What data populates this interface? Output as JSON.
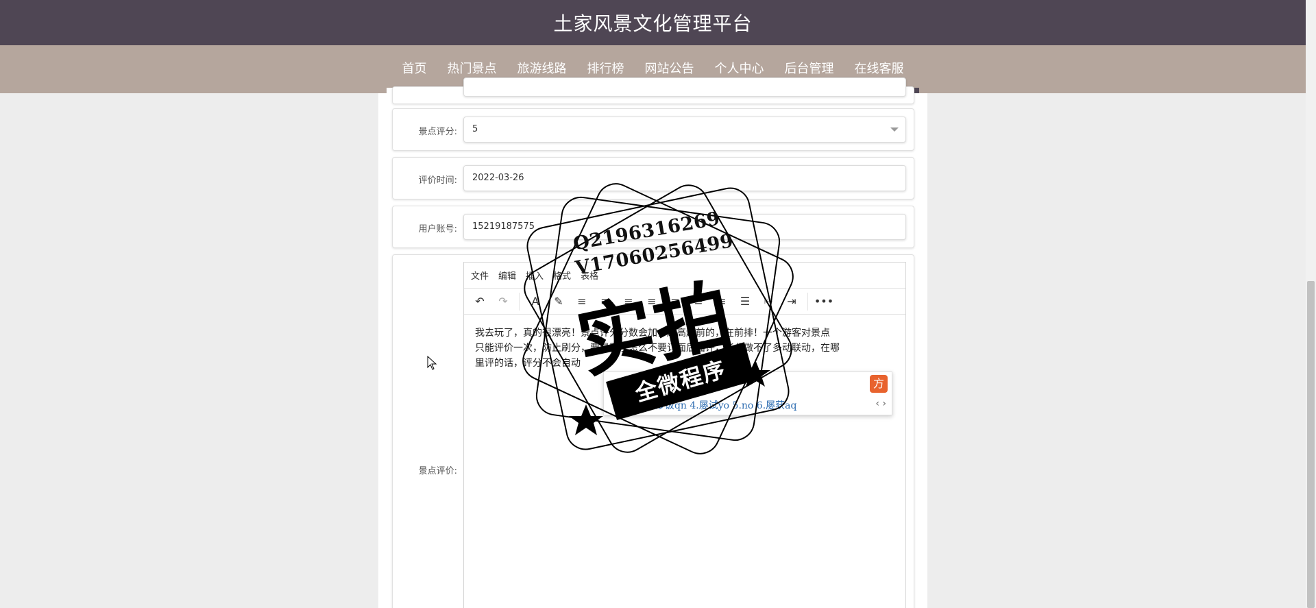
{
  "header": {
    "title": "土家风景文化管理平台"
  },
  "nav": {
    "items": [
      {
        "label": "首页",
        "active": true
      },
      {
        "label": "热门景点",
        "active": false
      },
      {
        "label": "旅游线路",
        "active": false
      },
      {
        "label": "排行榜",
        "active": false
      },
      {
        "label": "网站公告",
        "active": false
      },
      {
        "label": "个人中心",
        "active": false
      },
      {
        "label": "后台管理",
        "active": false
      },
      {
        "label": "在线客服",
        "active": false
      }
    ]
  },
  "form": {
    "rating": {
      "label": "景点评分:",
      "value": "5"
    },
    "time": {
      "label": "评价时间:",
      "value": "2022-03-26"
    },
    "account": {
      "label": "用户账号:",
      "value": "15219187575"
    },
    "review": {
      "label": "景点评价:",
      "menu": [
        "文件",
        "编辑",
        "插入",
        "格式",
        "表格"
      ],
      "body_line1": "我去玩了，真的很漂亮！景点评分分数会加，越高越前的，在前排！一个游客对景点",
      "body_line2": "只能评价一次，防止刷分，要是刷了怎么不要订面后面评，毕业做不了多动联动，在哪",
      "body_line3": "里评的话，评分不会自动"
    }
  },
  "ime": {
    "logo": "方",
    "candidates": "1. 2. 3.蛋炒饭qn 4.屡试yo 5.no 6.屡获aq",
    "arrows": "‹ ›"
  },
  "watermark": {
    "line1": "Q2196316269",
    "line2": "V17060256499",
    "big": "实拍",
    "banner": "全微程序"
  },
  "colors": {
    "header": "#4f4654",
    "nav": "#b5a69d"
  }
}
